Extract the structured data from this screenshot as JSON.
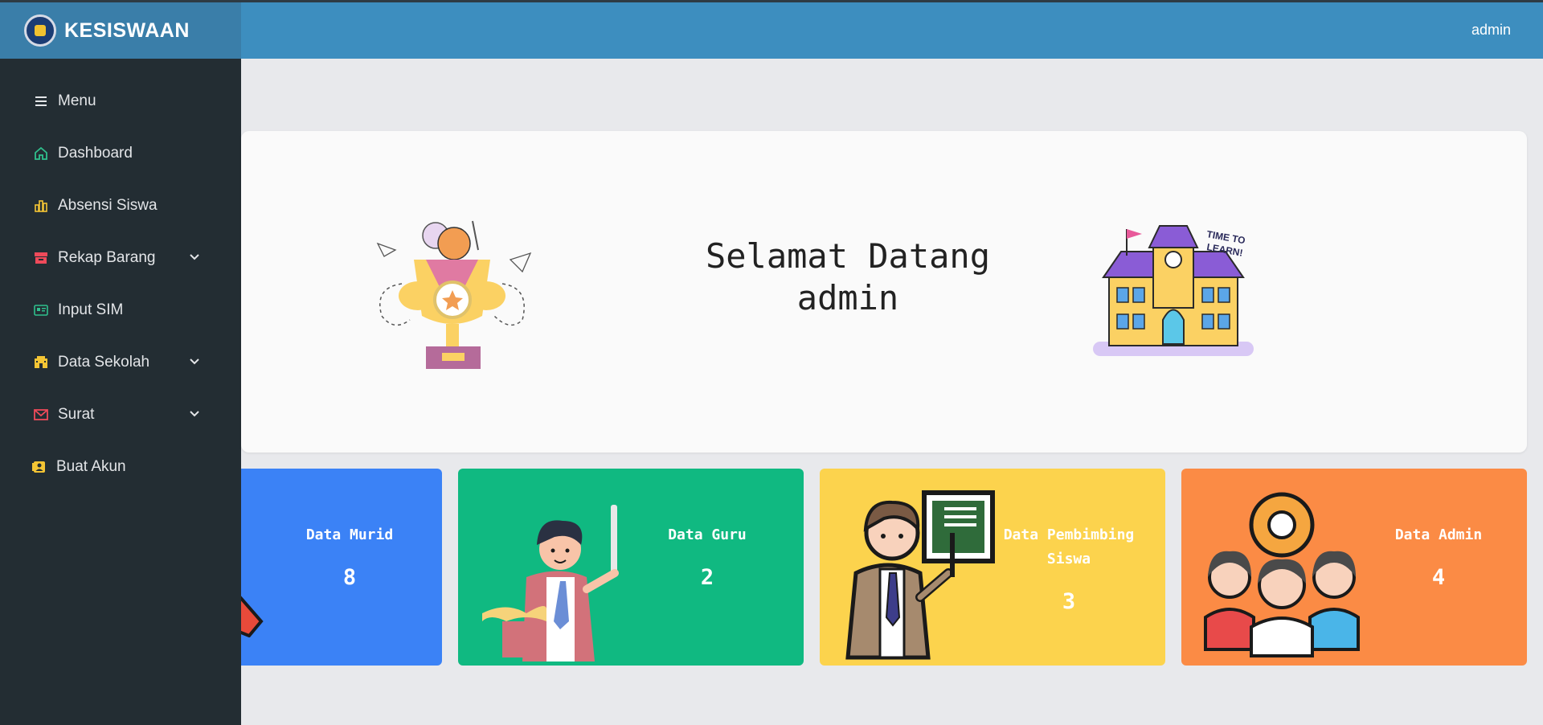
{
  "brand": {
    "title": "KESISWAAN"
  },
  "topbar": {
    "user": "admin"
  },
  "sidebar": {
    "items": [
      {
        "label": "Menu"
      },
      {
        "label": "Dashboard"
      },
      {
        "label": "Absensi Siswa"
      },
      {
        "label": "Rekap Barang"
      },
      {
        "label": "Input SIM"
      },
      {
        "label": "Data Sekolah"
      },
      {
        "label": "Surat"
      },
      {
        "label": "Buat Akun"
      }
    ]
  },
  "welcome": {
    "line1": "Selamat Datang",
    "line2": "admin"
  },
  "cards": [
    {
      "title": "Data Murid",
      "value": "8"
    },
    {
      "title": "Data Guru",
      "value": "2"
    },
    {
      "title": "Data Pembimbing Siswa",
      "value": "3"
    },
    {
      "title": "Data Admin",
      "value": "4"
    }
  ],
  "colors": {
    "topbar": "#3d8ebf",
    "sidebar": "#232d33",
    "card_blue": "#3b82f6",
    "card_green": "#10b981",
    "card_yellow": "#fcd34d",
    "card_orange": "#fb8b45"
  }
}
